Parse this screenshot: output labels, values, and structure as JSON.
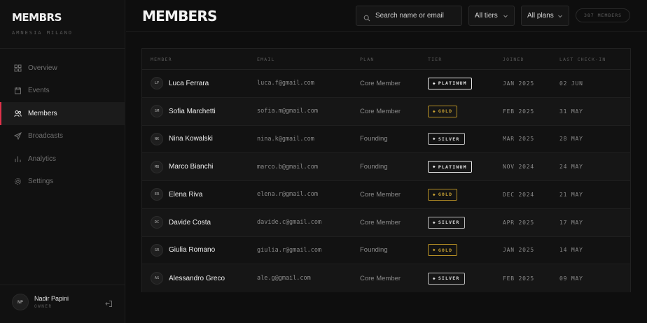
{
  "sidebar": {
    "brand": "MEMBRS",
    "brand_sub": "AMNESIA MILANO",
    "items": [
      {
        "label": "Overview",
        "icon": "grid-icon",
        "active": false
      },
      {
        "label": "Events",
        "icon": "calendar-icon",
        "active": false
      },
      {
        "label": "Members",
        "icon": "users-icon",
        "active": true
      },
      {
        "label": "Broadcasts",
        "icon": "send-icon",
        "active": false
      },
      {
        "label": "Analytics",
        "icon": "bar-chart-icon",
        "active": false
      },
      {
        "label": "Settings",
        "icon": "gear-icon",
        "active": false
      }
    ],
    "user": {
      "initials": "NP",
      "name": "Nadir Papini",
      "role": "OWNER"
    }
  },
  "header": {
    "title": "MEMBERS",
    "search_placeholder": "Search name or email",
    "tier_filter": "All tiers",
    "plan_filter": "All plans",
    "count": "387 MEMBERS"
  },
  "table": {
    "columns": [
      "MEMBER",
      "EMAIL",
      "PLAN",
      "TIER",
      "JOINED",
      "LAST CHECK-IN"
    ],
    "rows": [
      {
        "initials": "LF",
        "name": "Luca Ferrara",
        "email": "luca.f@gmail.com",
        "plan": "Core Member",
        "tier": "PLATINUM",
        "joined": "JAN 2025",
        "checkin": "02 JUN"
      },
      {
        "initials": "SM",
        "name": "Sofia Marchetti",
        "email": "sofia.m@gmail.com",
        "plan": "Core Member",
        "tier": "GOLD",
        "joined": "FEB 2025",
        "checkin": "31 MAY"
      },
      {
        "initials": "NK",
        "name": "Nina Kowalski",
        "email": "nina.k@gmail.com",
        "plan": "Founding",
        "tier": "SILVER",
        "joined": "MAR 2025",
        "checkin": "28 MAY"
      },
      {
        "initials": "MB",
        "name": "Marco Bianchi",
        "email": "marco.b@gmail.com",
        "plan": "Founding",
        "tier": "PLATINUM",
        "joined": "NOV 2024",
        "checkin": "24 MAY"
      },
      {
        "initials": "ER",
        "name": "Elena Riva",
        "email": "elena.r@gmail.com",
        "plan": "Core Member",
        "tier": "GOLD",
        "joined": "DEC 2024",
        "checkin": "21 MAY"
      },
      {
        "initials": "DC",
        "name": "Davide Costa",
        "email": "davide.c@gmail.com",
        "plan": "Core Member",
        "tier": "SILVER",
        "joined": "APR 2025",
        "checkin": "17 MAY"
      },
      {
        "initials": "GR",
        "name": "Giulia Romano",
        "email": "giulia.r@gmail.com",
        "plan": "Founding",
        "tier": "GOLD",
        "joined": "JAN 2025",
        "checkin": "14 MAY"
      },
      {
        "initials": "AG",
        "name": "Alessandro Greco",
        "email": "ale.g@gmail.com",
        "plan": "Core Member",
        "tier": "SILVER",
        "joined": "FEB 2025",
        "checkin": "09 MAY"
      }
    ]
  },
  "colors": {
    "accent": "#e0324a",
    "gold": "#c9a233",
    "background": "#0e0e0e"
  }
}
